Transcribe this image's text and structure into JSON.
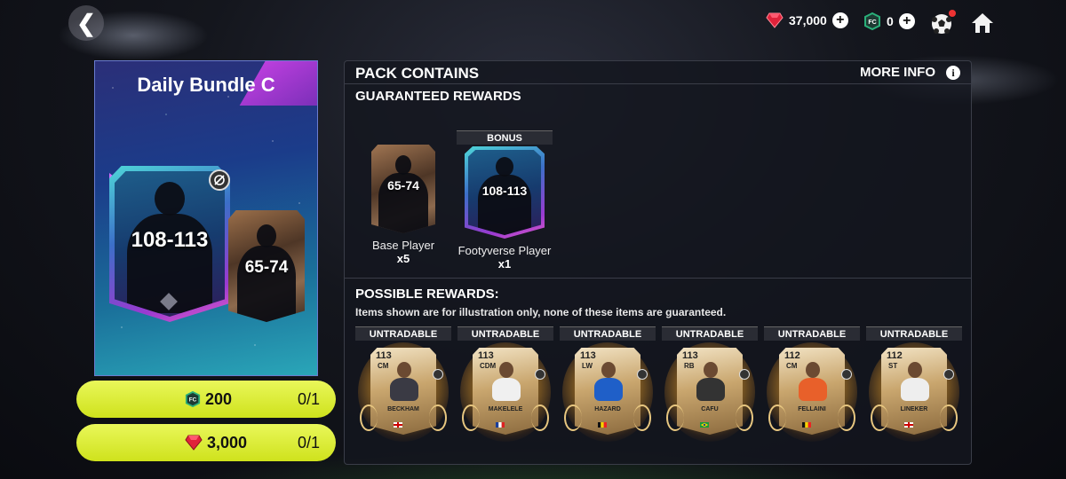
{
  "top_bar": {
    "gems": "37,000",
    "tokens": "0"
  },
  "pack": {
    "title": "Daily Bundle C",
    "main_card_rating": "108-113",
    "secondary_card_rating": "65-74"
  },
  "purchase": [
    {
      "price": "200",
      "currency_icon": "token-icon",
      "limit": "0/1"
    },
    {
      "price": "3,000",
      "currency_icon": "gem-icon",
      "limit": "0/1"
    }
  ],
  "panel": {
    "title": "PACK CONTAINS",
    "more_info": "MORE INFO",
    "guaranteed_title": "GUARANTEED REWARDS",
    "guaranteed": [
      {
        "rating": "65-74",
        "label": "Base Player",
        "count": "x5"
      },
      {
        "tag": "BONUS",
        "rating": "108-113",
        "label": "Footyverse Player",
        "count": "x1"
      }
    ],
    "possible_title": "POSSIBLE REWARDS:",
    "disclaimer": "Items shown are for illustration only, none of these items are guaranteed.",
    "possible": [
      {
        "tag": "UNTRADABLE",
        "ovr": "113",
        "pos": "CM",
        "name": "BECKHAM",
        "flag": "england"
      },
      {
        "tag": "UNTRADABLE",
        "ovr": "113",
        "pos": "CDM",
        "name": "MAKELELE",
        "flag": "france"
      },
      {
        "tag": "UNTRADABLE",
        "ovr": "113",
        "pos": "LW",
        "name": "HAZARD",
        "flag": "belgium"
      },
      {
        "tag": "UNTRADABLE",
        "ovr": "113",
        "pos": "RB",
        "name": "CAFU",
        "flag": "brazil"
      },
      {
        "tag": "UNTRADABLE",
        "ovr": "112",
        "pos": "CM",
        "name": "FELLAINI",
        "flag": "belgium"
      },
      {
        "tag": "UNTRADABLE",
        "ovr": "112",
        "pos": "ST",
        "name": "LINEKER",
        "flag": "england"
      }
    ]
  },
  "colors": {
    "buy_button": "#dcec33",
    "gem": "#e0223a",
    "token": "#2ab07a"
  }
}
